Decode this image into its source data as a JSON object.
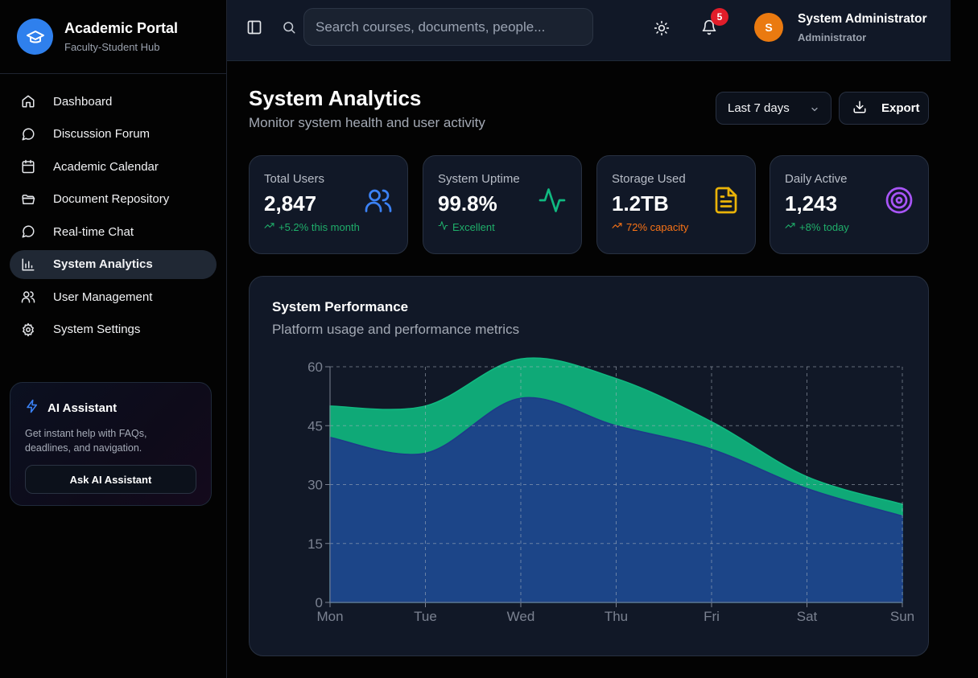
{
  "brand": {
    "title": "Academic Portal",
    "subtitle": "Faculty-Student Hub"
  },
  "nav": [
    {
      "label": "Dashboard",
      "icon": "home-icon"
    },
    {
      "label": "Discussion Forum",
      "icon": "message-circle-icon"
    },
    {
      "label": "Academic Calendar",
      "icon": "calendar-icon"
    },
    {
      "label": "Document Repository",
      "icon": "folder-icon"
    },
    {
      "label": "Real-time Chat",
      "icon": "message-circle-icon"
    },
    {
      "label": "System Analytics",
      "icon": "bar-chart-icon",
      "active": true
    },
    {
      "label": "User Management",
      "icon": "users-icon"
    },
    {
      "label": "System Settings",
      "icon": "gear-icon"
    }
  ],
  "ai": {
    "title": "AI Assistant",
    "description": "Get instant help with FAQs, deadlines, and navigation.",
    "button": "Ask AI Assistant"
  },
  "header": {
    "search_placeholder": "Search courses, documents, people...",
    "notification_count": "5",
    "avatar_initial": "S",
    "user_name": "System Administrator",
    "user_role": "Administrator"
  },
  "page": {
    "title": "System Analytics",
    "subtitle": "Monitor system health and user activity",
    "range": "Last 7 days",
    "export": "Export"
  },
  "stats": [
    {
      "label": "Total Users",
      "value": "2,847",
      "note": "+5.2% this month",
      "color": "#22c55e",
      "icon": "users-icon"
    },
    {
      "label": "System Uptime",
      "value": "99.8%",
      "note": "Excellent",
      "color": "#22c55e",
      "icon": "activity-icon"
    },
    {
      "label": "Storage Used",
      "value": "1.2TB",
      "note": "72% capacity",
      "color": "#f97316",
      "icon": "file-text-icon"
    },
    {
      "label": "Daily Active",
      "value": "1,243",
      "note": "+8% today",
      "color": "#22c55e",
      "icon": "target-icon"
    }
  ],
  "chart": {
    "title": "System Performance",
    "subtitle": "Platform usage and performance metrics"
  },
  "chart_data": {
    "type": "area",
    "stacked": true,
    "categories": [
      "Mon",
      "Tue",
      "Wed",
      "Thu",
      "Fri",
      "Sat",
      "Sun"
    ],
    "ylim": [
      0,
      60
    ],
    "yticks": [
      0,
      15,
      30,
      45,
      60
    ],
    "grid": true,
    "series": [
      {
        "values": [
          42,
          38,
          52,
          45,
          39,
          29,
          22
        ],
        "color": "#1e3a8a"
      },
      {
        "values": [
          8,
          12,
          10,
          12,
          7,
          3,
          3
        ],
        "color": "#10b981"
      }
    ]
  }
}
